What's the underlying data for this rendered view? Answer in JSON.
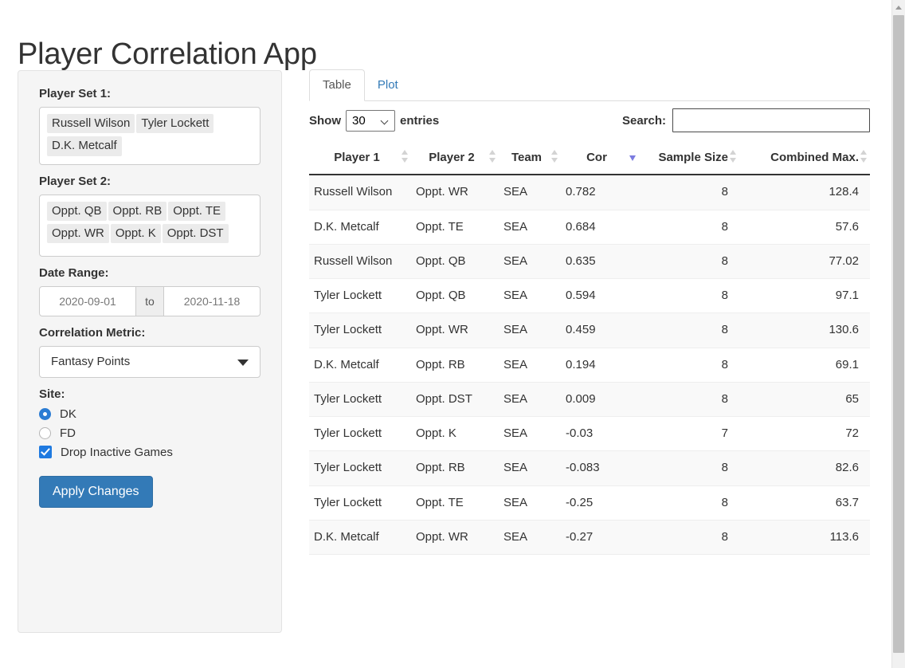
{
  "app": {
    "title": "Player Correlation App",
    "accent_color": "#337ab7",
    "link_color": "#337ab7",
    "sort_active_color": "#7b7be0"
  },
  "sidebar": {
    "player_set_1": {
      "label": "Player Set 1:",
      "tokens": [
        "Russell Wilson",
        "Tyler Lockett",
        "D.K. Metcalf"
      ]
    },
    "player_set_2": {
      "label": "Player Set 2:",
      "tokens": [
        "Oppt. QB",
        "Oppt. RB",
        "Oppt. TE",
        "Oppt. WR",
        "Oppt. K",
        "Oppt. DST"
      ]
    },
    "date_range": {
      "label": "Date Range:",
      "start": "2020-09-01",
      "separator": "to",
      "end": "2020-11-18"
    },
    "correlation_metric": {
      "label": "Correlation Metric:",
      "value": "Fantasy Points"
    },
    "site": {
      "label": "Site:",
      "options": [
        {
          "label": "DK",
          "selected": true
        },
        {
          "label": "FD",
          "selected": false
        }
      ]
    },
    "drop_inactive": {
      "label": "Drop Inactive Games",
      "checked": true
    },
    "apply_button": "Apply Changes"
  },
  "main": {
    "tabs": [
      {
        "label": "Table",
        "active": true
      },
      {
        "label": "Plot",
        "active": false
      }
    ],
    "controls": {
      "show_label": "Show",
      "entries_value": "30",
      "entries_label": "entries",
      "search_label": "Search:",
      "search_value": "",
      "search_placeholder": ""
    },
    "table": {
      "columns": [
        {
          "label": "Player 1",
          "sort": "none"
        },
        {
          "label": "Player 2",
          "sort": "none"
        },
        {
          "label": "Team",
          "sort": "none"
        },
        {
          "label": "Cor",
          "sort": "desc"
        },
        {
          "label": "Sample Size",
          "sort": "none"
        },
        {
          "label": "Combined Max.",
          "sort": "none"
        }
      ],
      "rows": [
        {
          "p1": "Russell Wilson",
          "p2": "Oppt. WR",
          "team": "SEA",
          "cor": "0.782",
          "n": "8",
          "max": "128.4"
        },
        {
          "p1": "D.K. Metcalf",
          "p2": "Oppt. TE",
          "team": "SEA",
          "cor": "0.684",
          "n": "8",
          "max": "57.6"
        },
        {
          "p1": "Russell Wilson",
          "p2": "Oppt. QB",
          "team": "SEA",
          "cor": "0.635",
          "n": "8",
          "max": "77.02"
        },
        {
          "p1": "Tyler Lockett",
          "p2": "Oppt. QB",
          "team": "SEA",
          "cor": "0.594",
          "n": "8",
          "max": "97.1"
        },
        {
          "p1": "Tyler Lockett",
          "p2": "Oppt. WR",
          "team": "SEA",
          "cor": "0.459",
          "n": "8",
          "max": "130.6"
        },
        {
          "p1": "D.K. Metcalf",
          "p2": "Oppt. RB",
          "team": "SEA",
          "cor": "0.194",
          "n": "8",
          "max": "69.1"
        },
        {
          "p1": "Tyler Lockett",
          "p2": "Oppt. DST",
          "team": "SEA",
          "cor": "0.009",
          "n": "8",
          "max": "65"
        },
        {
          "p1": "Tyler Lockett",
          "p2": "Oppt. K",
          "team": "SEA",
          "cor": "-0.03",
          "n": "7",
          "max": "72"
        },
        {
          "p1": "Tyler Lockett",
          "p2": "Oppt. RB",
          "team": "SEA",
          "cor": "-0.083",
          "n": "8",
          "max": "82.6"
        },
        {
          "p1": "Tyler Lockett",
          "p2": "Oppt. TE",
          "team": "SEA",
          "cor": "-0.25",
          "n": "8",
          "max": "63.7"
        },
        {
          "p1": "D.K. Metcalf",
          "p2": "Oppt. WR",
          "team": "SEA",
          "cor": "-0.27",
          "n": "8",
          "max": "113.6"
        }
      ]
    }
  }
}
